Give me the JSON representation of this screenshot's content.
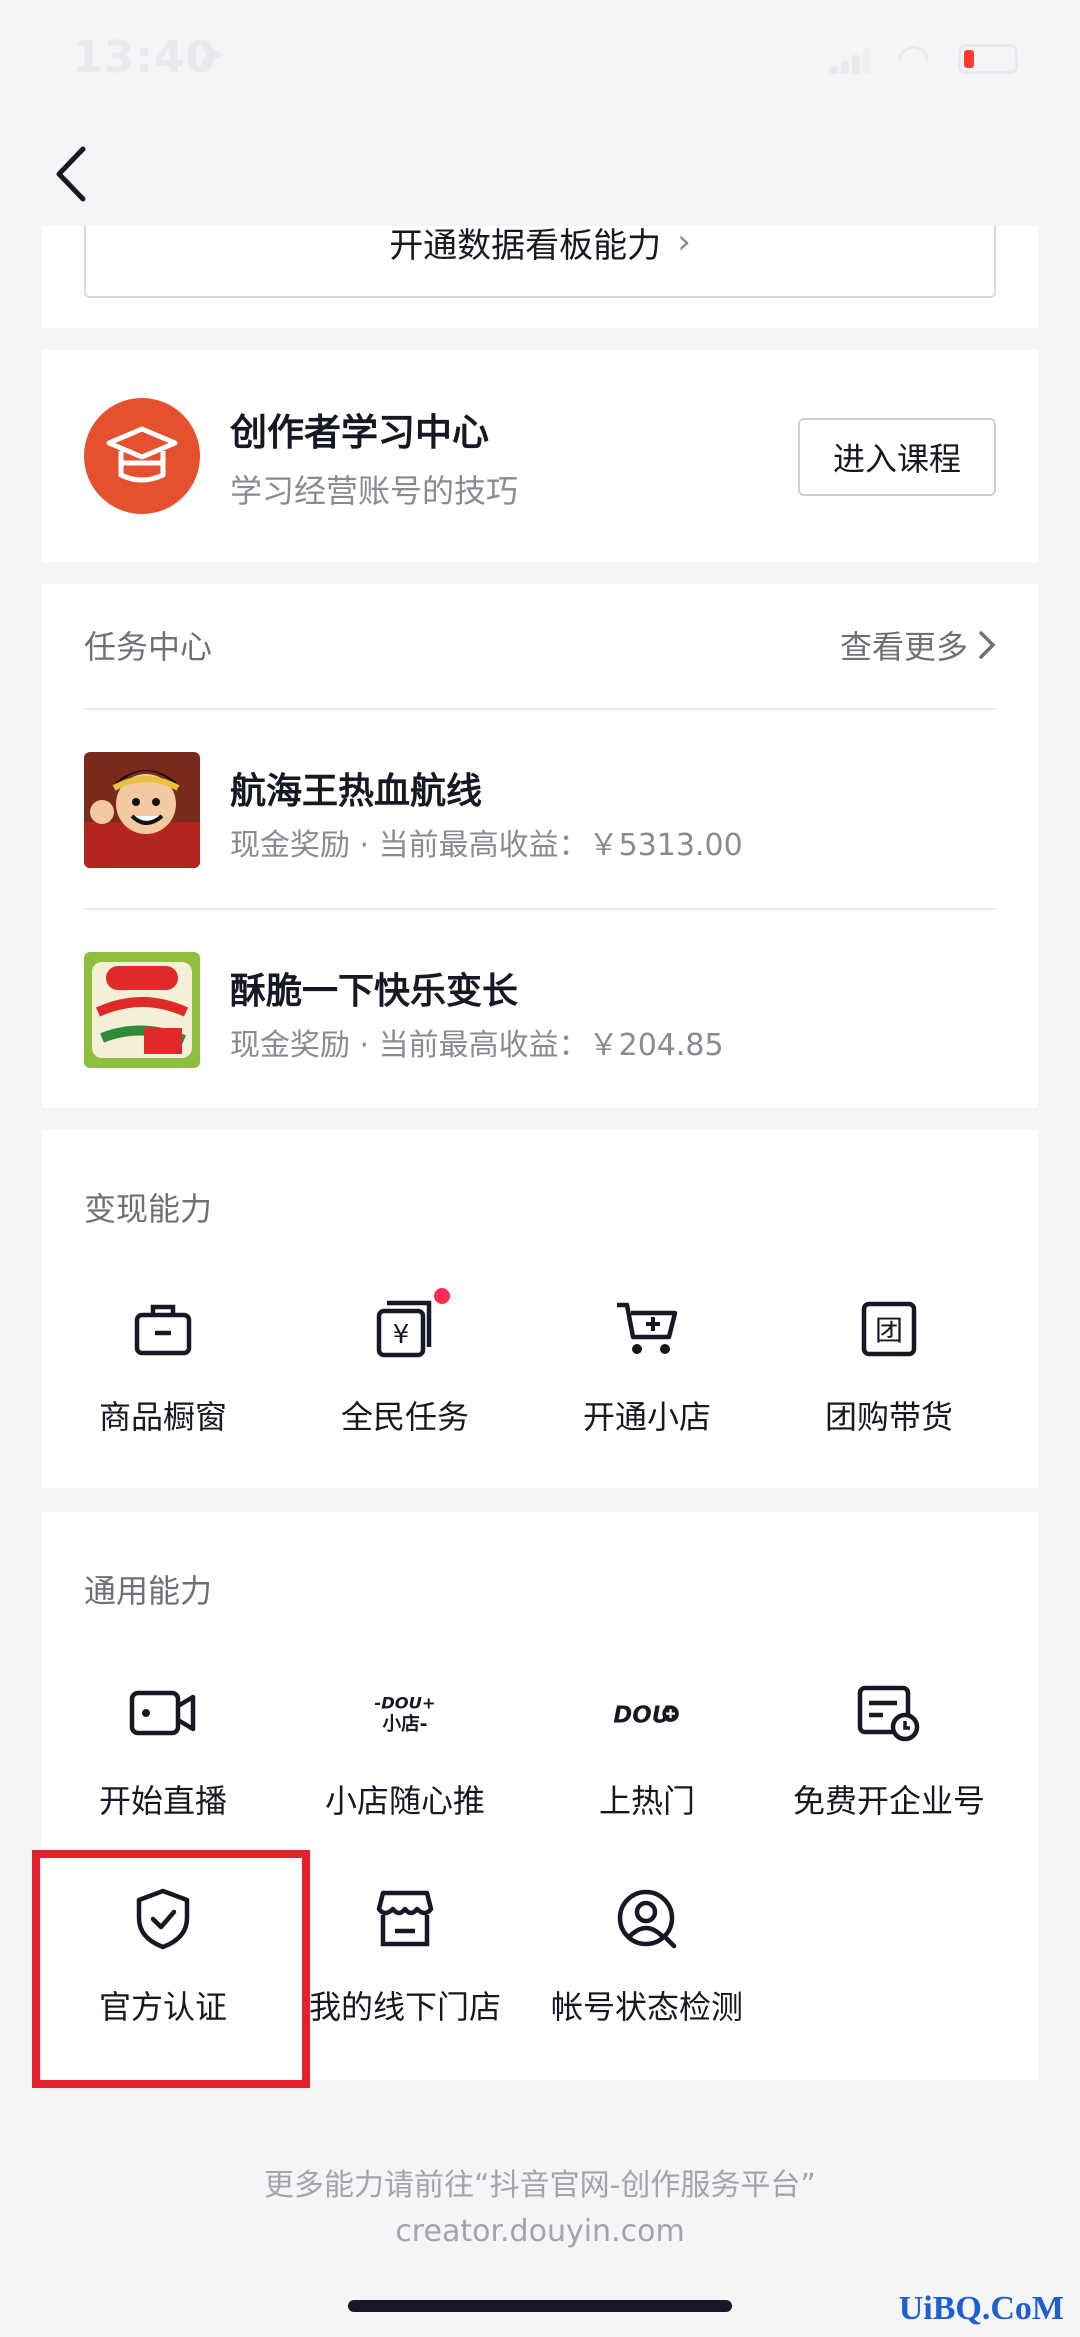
{
  "status_bar": {
    "time": "13:40",
    "battery_color": "#ff3b30"
  },
  "nav": {
    "back_icon": "chevron-left-icon"
  },
  "top_card": {
    "button_label": "开通数据看板能力"
  },
  "learning": {
    "title": "创作者学习中心",
    "subtitle": "学习经营账号的技巧",
    "button": "进入课程",
    "icon_color": "#e5512f"
  },
  "task_center": {
    "title": "任务中心",
    "more": "查看更多",
    "items": [
      {
        "name": "航海王热血航线",
        "desc": "现金奖励 · 当前最高收益：￥5313.00"
      },
      {
        "name": "酥脆一下快乐变长",
        "desc": "现金奖励 · 当前最高收益：￥204.85"
      }
    ]
  },
  "monetize": {
    "title": "变现能力",
    "items": [
      {
        "label": "商品橱窗",
        "icon": "showcase-icon"
      },
      {
        "label": "全民任务",
        "icon": "task-icon"
      },
      {
        "label": "开通小店",
        "icon": "cart-icon"
      },
      {
        "label": "团购带货",
        "icon": "group-buy-icon"
      }
    ]
  },
  "general": {
    "title": "通用能力",
    "items": [
      {
        "label": "开始直播",
        "icon": "live-camera-icon"
      },
      {
        "label": "小店随心推",
        "icon": "dou-shop-icon"
      },
      {
        "label": "上热门",
        "icon": "dou-plus-icon"
      },
      {
        "label": "免费开企业号",
        "icon": "enterprise-icon"
      },
      {
        "label": "官方认证",
        "icon": "shield-check-icon"
      },
      {
        "label": "我的线下门店",
        "icon": "store-icon"
      },
      {
        "label": "帐号状态检测",
        "icon": "account-check-icon"
      }
    ]
  },
  "footer": {
    "line1": "更多能力请前往“抖音官网-创作服务平台”",
    "line2": "creator.douyin.com"
  },
  "watermark": "UiBQ.CoM",
  "colors": {
    "highlight": "#e4202c",
    "badge": "#fe2c55"
  }
}
